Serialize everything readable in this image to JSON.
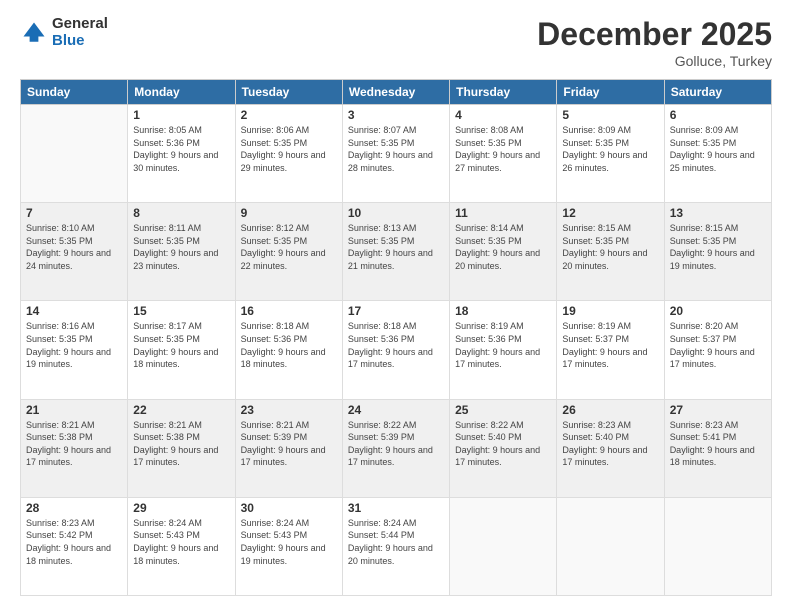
{
  "logo": {
    "general": "General",
    "blue": "Blue"
  },
  "title": "December 2025",
  "location": "Golluce, Turkey",
  "weekdays": [
    "Sunday",
    "Monday",
    "Tuesday",
    "Wednesday",
    "Thursday",
    "Friday",
    "Saturday"
  ],
  "weeks": [
    [
      {
        "day": "",
        "sunrise": "",
        "sunset": "",
        "daylight": ""
      },
      {
        "day": "1",
        "sunrise": "Sunrise: 8:05 AM",
        "sunset": "Sunset: 5:36 PM",
        "daylight": "Daylight: 9 hours and 30 minutes."
      },
      {
        "day": "2",
        "sunrise": "Sunrise: 8:06 AM",
        "sunset": "Sunset: 5:35 PM",
        "daylight": "Daylight: 9 hours and 29 minutes."
      },
      {
        "day": "3",
        "sunrise": "Sunrise: 8:07 AM",
        "sunset": "Sunset: 5:35 PM",
        "daylight": "Daylight: 9 hours and 28 minutes."
      },
      {
        "day": "4",
        "sunrise": "Sunrise: 8:08 AM",
        "sunset": "Sunset: 5:35 PM",
        "daylight": "Daylight: 9 hours and 27 minutes."
      },
      {
        "day": "5",
        "sunrise": "Sunrise: 8:09 AM",
        "sunset": "Sunset: 5:35 PM",
        "daylight": "Daylight: 9 hours and 26 minutes."
      },
      {
        "day": "6",
        "sunrise": "Sunrise: 8:09 AM",
        "sunset": "Sunset: 5:35 PM",
        "daylight": "Daylight: 9 hours and 25 minutes."
      }
    ],
    [
      {
        "day": "7",
        "sunrise": "Sunrise: 8:10 AM",
        "sunset": "Sunset: 5:35 PM",
        "daylight": "Daylight: 9 hours and 24 minutes."
      },
      {
        "day": "8",
        "sunrise": "Sunrise: 8:11 AM",
        "sunset": "Sunset: 5:35 PM",
        "daylight": "Daylight: 9 hours and 23 minutes."
      },
      {
        "day": "9",
        "sunrise": "Sunrise: 8:12 AM",
        "sunset": "Sunset: 5:35 PM",
        "daylight": "Daylight: 9 hours and 22 minutes."
      },
      {
        "day": "10",
        "sunrise": "Sunrise: 8:13 AM",
        "sunset": "Sunset: 5:35 PM",
        "daylight": "Daylight: 9 hours and 21 minutes."
      },
      {
        "day": "11",
        "sunrise": "Sunrise: 8:14 AM",
        "sunset": "Sunset: 5:35 PM",
        "daylight": "Daylight: 9 hours and 20 minutes."
      },
      {
        "day": "12",
        "sunrise": "Sunrise: 8:15 AM",
        "sunset": "Sunset: 5:35 PM",
        "daylight": "Daylight: 9 hours and 20 minutes."
      },
      {
        "day": "13",
        "sunrise": "Sunrise: 8:15 AM",
        "sunset": "Sunset: 5:35 PM",
        "daylight": "Daylight: 9 hours and 19 minutes."
      }
    ],
    [
      {
        "day": "14",
        "sunrise": "Sunrise: 8:16 AM",
        "sunset": "Sunset: 5:35 PM",
        "daylight": "Daylight: 9 hours and 19 minutes."
      },
      {
        "day": "15",
        "sunrise": "Sunrise: 8:17 AM",
        "sunset": "Sunset: 5:35 PM",
        "daylight": "Daylight: 9 hours and 18 minutes."
      },
      {
        "day": "16",
        "sunrise": "Sunrise: 8:18 AM",
        "sunset": "Sunset: 5:36 PM",
        "daylight": "Daylight: 9 hours and 18 minutes."
      },
      {
        "day": "17",
        "sunrise": "Sunrise: 8:18 AM",
        "sunset": "Sunset: 5:36 PM",
        "daylight": "Daylight: 9 hours and 17 minutes."
      },
      {
        "day": "18",
        "sunrise": "Sunrise: 8:19 AM",
        "sunset": "Sunset: 5:36 PM",
        "daylight": "Daylight: 9 hours and 17 minutes."
      },
      {
        "day": "19",
        "sunrise": "Sunrise: 8:19 AM",
        "sunset": "Sunset: 5:37 PM",
        "daylight": "Daylight: 9 hours and 17 minutes."
      },
      {
        "day": "20",
        "sunrise": "Sunrise: 8:20 AM",
        "sunset": "Sunset: 5:37 PM",
        "daylight": "Daylight: 9 hours and 17 minutes."
      }
    ],
    [
      {
        "day": "21",
        "sunrise": "Sunrise: 8:21 AM",
        "sunset": "Sunset: 5:38 PM",
        "daylight": "Daylight: 9 hours and 17 minutes."
      },
      {
        "day": "22",
        "sunrise": "Sunrise: 8:21 AM",
        "sunset": "Sunset: 5:38 PM",
        "daylight": "Daylight: 9 hours and 17 minutes."
      },
      {
        "day": "23",
        "sunrise": "Sunrise: 8:21 AM",
        "sunset": "Sunset: 5:39 PM",
        "daylight": "Daylight: 9 hours and 17 minutes."
      },
      {
        "day": "24",
        "sunrise": "Sunrise: 8:22 AM",
        "sunset": "Sunset: 5:39 PM",
        "daylight": "Daylight: 9 hours and 17 minutes."
      },
      {
        "day": "25",
        "sunrise": "Sunrise: 8:22 AM",
        "sunset": "Sunset: 5:40 PM",
        "daylight": "Daylight: 9 hours and 17 minutes."
      },
      {
        "day": "26",
        "sunrise": "Sunrise: 8:23 AM",
        "sunset": "Sunset: 5:40 PM",
        "daylight": "Daylight: 9 hours and 17 minutes."
      },
      {
        "day": "27",
        "sunrise": "Sunrise: 8:23 AM",
        "sunset": "Sunset: 5:41 PM",
        "daylight": "Daylight: 9 hours and 18 minutes."
      }
    ],
    [
      {
        "day": "28",
        "sunrise": "Sunrise: 8:23 AM",
        "sunset": "Sunset: 5:42 PM",
        "daylight": "Daylight: 9 hours and 18 minutes."
      },
      {
        "day": "29",
        "sunrise": "Sunrise: 8:24 AM",
        "sunset": "Sunset: 5:43 PM",
        "daylight": "Daylight: 9 hours and 18 minutes."
      },
      {
        "day": "30",
        "sunrise": "Sunrise: 8:24 AM",
        "sunset": "Sunset: 5:43 PM",
        "daylight": "Daylight: 9 hours and 19 minutes."
      },
      {
        "day": "31",
        "sunrise": "Sunrise: 8:24 AM",
        "sunset": "Sunset: 5:44 PM",
        "daylight": "Daylight: 9 hours and 20 minutes."
      },
      {
        "day": "",
        "sunrise": "",
        "sunset": "",
        "daylight": ""
      },
      {
        "day": "",
        "sunrise": "",
        "sunset": "",
        "daylight": ""
      },
      {
        "day": "",
        "sunrise": "",
        "sunset": "",
        "daylight": ""
      }
    ]
  ]
}
